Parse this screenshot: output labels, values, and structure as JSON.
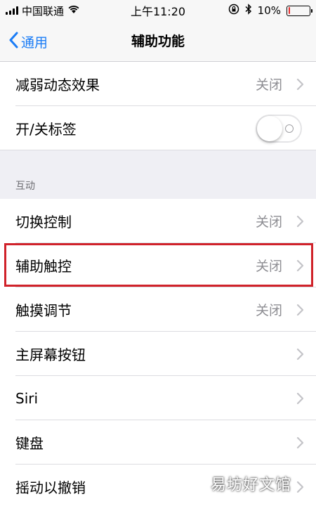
{
  "status_bar": {
    "carrier": "中国联通",
    "time": "上午11:20",
    "battery_text": "10%",
    "battery_level": 0.1,
    "battery_color": "#e52a2a"
  },
  "nav": {
    "back_label": "通用",
    "title": "辅助功能",
    "accent_color": "#1a7cf6"
  },
  "group_top": {
    "rows": [
      {
        "label": "减弱动态效果",
        "value": "关闭"
      },
      {
        "label": "开/关标签",
        "toggle": "off"
      }
    ]
  },
  "section_interaction": {
    "header": "互动",
    "rows": [
      {
        "label": "切换控制",
        "value": "关闭"
      },
      {
        "label": "辅助触控",
        "value": "关闭",
        "highlighted": true
      },
      {
        "label": "触摸调节",
        "value": "关闭"
      },
      {
        "label": "主屏幕按钮",
        "value": ""
      },
      {
        "label": "Siri",
        "value": ""
      },
      {
        "label": "键盘",
        "value": ""
      },
      {
        "label": "摇动以撤销",
        "value": ""
      }
    ]
  },
  "watermark": "易坊好文馆",
  "highlight_color": "#d0222a"
}
